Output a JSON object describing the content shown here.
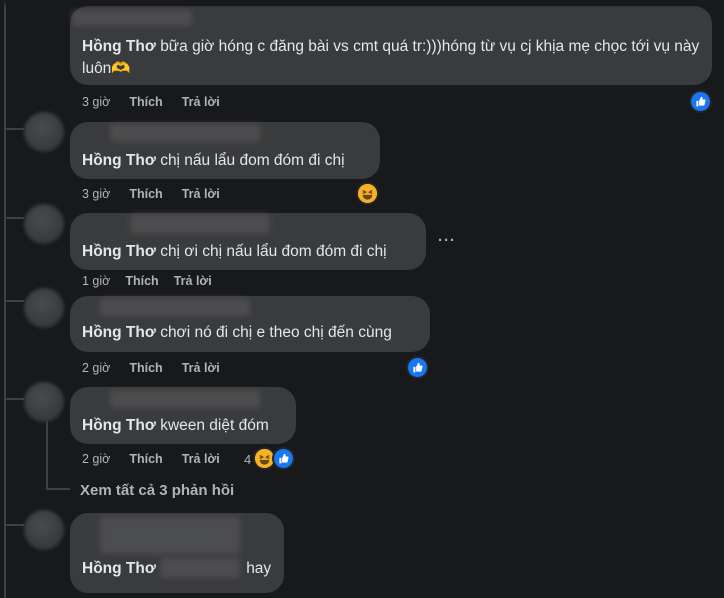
{
  "comments": [
    {
      "author": "Hồng Thơ",
      "text": "bữa giờ hóng c đăng bài vs cmt quá tr:)))hóng từ vụ cj khịa mẹ chọc tới vụ này luôn🫶",
      "time": "3 giờ",
      "like": "Thích",
      "reply": "Trả lời",
      "reactions": [
        "like"
      ]
    },
    {
      "author": "Hồng Thơ",
      "text": "chị nấu lẩu đom đóm đi chị",
      "time": "3 giờ",
      "like": "Thích",
      "reply": "Trả lời",
      "reactions": [
        "haha"
      ]
    },
    {
      "author": "Hồng Thơ",
      "text": "chị ơi chị nấu lẩu đom đóm đi chị",
      "time": "1 giờ",
      "like": "Thích",
      "reply": "Trả lời",
      "reactions": [],
      "more": "···"
    },
    {
      "author": "Hồng Thơ",
      "text": "chơi nó đi chị e theo chị đến cùng",
      "time": "2 giờ",
      "like": "Thích",
      "reply": "Trả lời",
      "reactions": [
        "like"
      ]
    },
    {
      "author": "Hồng Thơ",
      "text": "kween diệt đóm",
      "time": "2 giờ",
      "like": "Thích",
      "reply": "Trả lời",
      "reactions": [
        "haha",
        "like"
      ],
      "reaction_count": "4"
    },
    {
      "author": "Hồng Thơ",
      "text": "hay",
      "time": "",
      "like": "",
      "reply": "",
      "reactions": []
    }
  ],
  "view_replies": "Xem tất cả 3 phản hồi",
  "colors": {
    "background": "#18191a",
    "bubble": "#3a3b3c",
    "text": "#e4e6eb",
    "secondary": "#b0b3b8",
    "like_blue": "#1877f2",
    "haha_yellow": "#f7b125"
  }
}
